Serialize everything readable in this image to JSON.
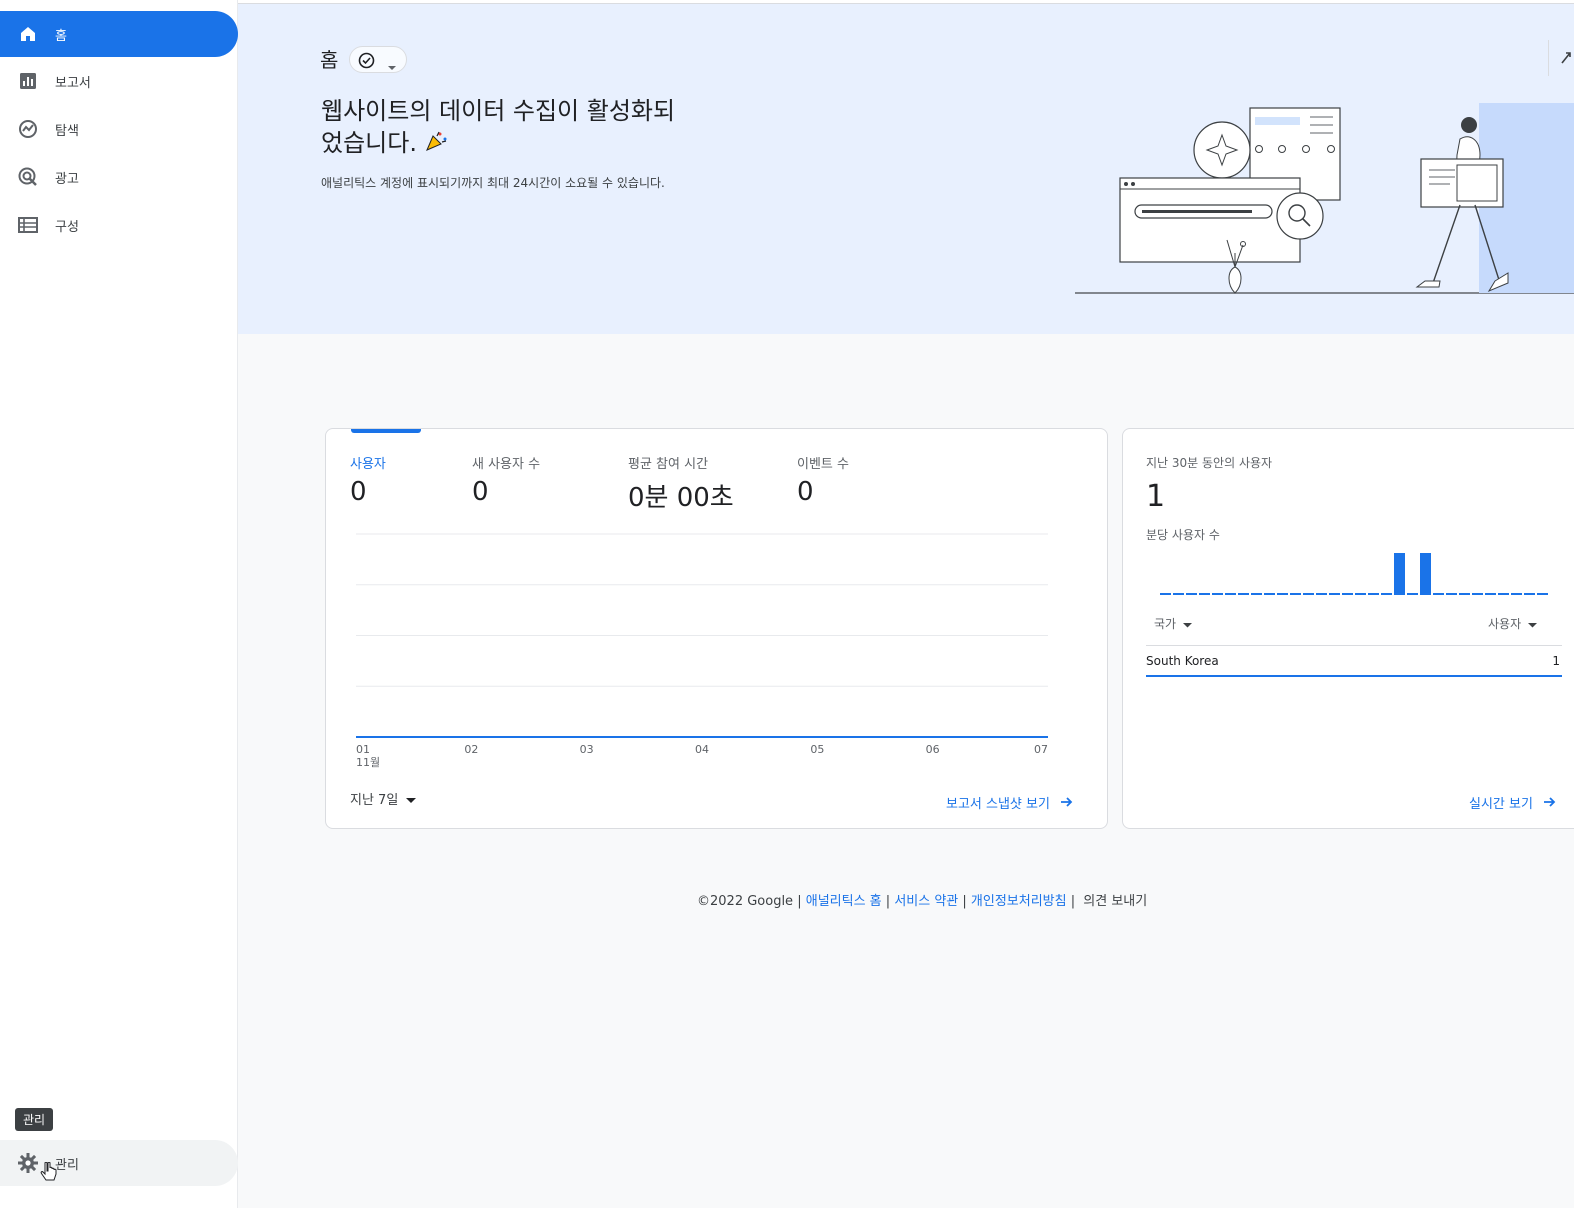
{
  "sidebar": {
    "items": [
      {
        "label": "홈",
        "icon": "home-icon",
        "active": true
      },
      {
        "label": "보고서",
        "icon": "reports-icon"
      },
      {
        "label": "탐색",
        "icon": "explore-icon"
      },
      {
        "label": "광고",
        "icon": "advertising-icon"
      },
      {
        "label": "구성",
        "icon": "configure-icon"
      }
    ],
    "admin_tooltip": "관리",
    "admin_label": "관리",
    "admin_icon": "gear-icon"
  },
  "header": {
    "title": "홈",
    "headline": "웹사이트의 데이터 수집이 활성화되었습니다.",
    "headline_line1": "웹사이트의 데이터 수집이 활성화되",
    "headline_line2": "었습니다.",
    "subtext": "애널리틱스 계정에 표시되기까지 최대 24시간이 소요될 수 있습니다."
  },
  "overview": {
    "metrics": [
      {
        "label": "사용자",
        "value": "0",
        "active": true
      },
      {
        "label": "새 사용자 수",
        "value": "0"
      },
      {
        "label": "평균 참여 시간",
        "value": "0분 00초"
      },
      {
        "label": "이벤트 수",
        "value": "0"
      }
    ],
    "range_label": "지난 7일",
    "snapshot_link": "보고서 스냅샷 보기"
  },
  "chart_data": {
    "type": "line",
    "x": [
      "01",
      "02",
      "03",
      "04",
      "05",
      "06",
      "07"
    ],
    "x_sublabel": "11월",
    "series": [
      {
        "values": [
          0,
          0,
          0,
          0,
          0,
          0,
          0
        ]
      }
    ],
    "grid": true
  },
  "realtime": {
    "title": "지난 30분 동안의 사용자",
    "value": "1",
    "per_minute_label": "분당 사용자 수",
    "per_minute_values": [
      0,
      0,
      0,
      0,
      0,
      0,
      0,
      0,
      0,
      0,
      0,
      0,
      0,
      0,
      0,
      0,
      0,
      0,
      1,
      0,
      1,
      0,
      0,
      0,
      0,
      0,
      0,
      0,
      0,
      0
    ],
    "col_country": "국가",
    "col_users": "사용자",
    "rows": [
      {
        "country": "South Korea",
        "users": "1"
      }
    ],
    "link": "실시간 보기"
  },
  "footer": {
    "copyright": "©2022 Google",
    "sep": "|",
    "links": [
      "애널리틱스 홈",
      "서비스 약관",
      "개인정보처리방침"
    ],
    "feedback": "의견 보내기"
  },
  "colors": {
    "accent": "#1a73e8",
    "hero_bg": "#e8f0fe"
  }
}
